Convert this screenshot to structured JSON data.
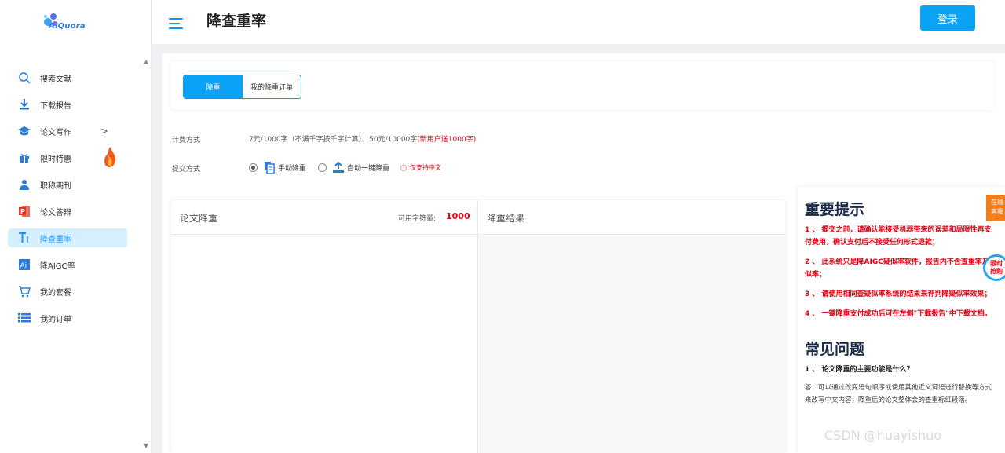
{
  "app": {
    "logo_text": "AiQuora",
    "page_title": "降查重率",
    "login_label": "登录"
  },
  "sidebar": {
    "items": [
      {
        "label": "搜索文献",
        "icon": "search-icon"
      },
      {
        "label": "下载报告",
        "icon": "download-icon"
      },
      {
        "label": "论文写作",
        "icon": "graduation-cap-icon"
      },
      {
        "label": "限时特惠",
        "icon": "gift-icon"
      },
      {
        "label": "职称期刊",
        "icon": "user-icon"
      },
      {
        "label": "论文答辩",
        "icon": "ppt-icon"
      },
      {
        "label": "降查重率",
        "icon": "text-icon"
      },
      {
        "label": "降AIGC率",
        "icon": "ai-icon"
      },
      {
        "label": "我的套餐",
        "icon": "cart-icon"
      },
      {
        "label": "我的订单",
        "icon": "list-icon"
      }
    ],
    "expand_glyph": ">"
  },
  "tabs": [
    {
      "label": "降重"
    },
    {
      "label": "我的降重订单"
    }
  ],
  "billing": {
    "label": "计费方式",
    "text": "7元/1000字（不满千字按千字计算），50元/10000字",
    "promo": "(新用户送1000字)"
  },
  "submit": {
    "label": "提交方式",
    "option_manual": "手动降重",
    "option_auto": "自动一键降重",
    "note": "仅支持中文"
  },
  "editor": {
    "left_title": "论文降重",
    "quota_label": "可用字符量:",
    "quota_value": "1000",
    "right_title": "降重结果"
  },
  "tips": {
    "title": "重要提示",
    "items": [
      "1 、 提交之前，请确认能接受机器带来的误差和局限性再支付费用，确认支付后不接受任何形式退款；",
      "2 、 此系统只是降AIGC疑似率软件，报告内不含查重率及疑似率；",
      "3 、 请使用相同查疑似率系统的结果来评判降疑似率效果；",
      "4 、 一键降重支付成功后可在左侧\"下载报告\"中下载文档。"
    ],
    "faq_title": "常见问题",
    "faq_question": "1 、 论文降重的主要功能是什么？",
    "faq_answer": "答：可以通过改变语句顺序或使用其他近义词语进行替换等方式来改写中文内容，降重后的论文整体会的查重标红段落。"
  },
  "floating": {
    "online": "在线客服",
    "flash": "限时抢购"
  },
  "watermark": "CSDN @huayishuo",
  "colors": {
    "accent": "#0aa3f5",
    "promo": "#e60012"
  }
}
